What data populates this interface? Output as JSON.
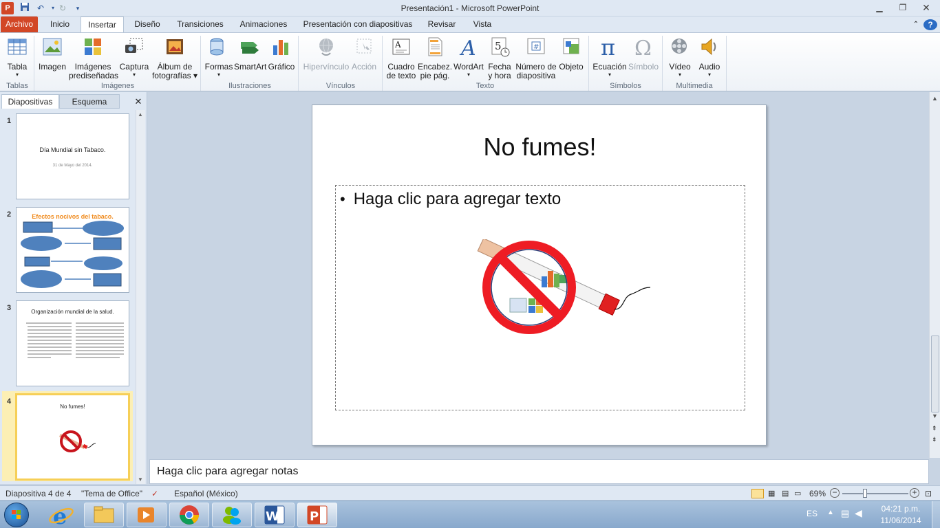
{
  "window": {
    "title": "Presentación1  -  Microsoft PowerPoint"
  },
  "quick_access": {
    "icons": [
      "powerpoint-logo-icon",
      "save-icon",
      "undo-icon",
      "redo-icon",
      "customize-icon"
    ]
  },
  "tabs": [
    {
      "label": "Archivo"
    },
    {
      "label": "Inicio"
    },
    {
      "label": "Insertar"
    },
    {
      "label": "Diseño"
    },
    {
      "label": "Transiciones"
    },
    {
      "label": "Animaciones"
    },
    {
      "label": "Presentación con diapositivas"
    },
    {
      "label": "Revisar"
    },
    {
      "label": "Vista"
    }
  ],
  "ribbon": {
    "buttons": {
      "tabla": "Tabla",
      "imagen": "Imagen",
      "imagenes1": "Imágenes",
      "imagenes2": "prediseñadas",
      "captura": "Captura",
      "album1": "Álbum de",
      "album2": "fotografías",
      "formas": "Formas",
      "smartart": "SmartArt",
      "grafico": "Gráfico",
      "hipervinculo": "Hipervínculo",
      "accion": "Acción",
      "cuadro1": "Cuadro",
      "cuadro2": "de texto",
      "encabez1": "Encabez.",
      "encabez2": "pie pág.",
      "wordart": "WordArt",
      "fecha1": "Fecha",
      "fecha2": "y hora",
      "numero1": "Número de",
      "numero2": "diapositiva",
      "objeto": "Objeto",
      "ecuacion": "Ecuación",
      "simbolo": "Símbolo",
      "video": "Vídeo",
      "audio": "Audio"
    },
    "groups": {
      "tablas": "Tablas",
      "imagenes": "Imágenes",
      "ilustraciones": "Ilustraciones",
      "vinculos": "Vínculos",
      "texto": "Texto",
      "simbolos": "Símbolos",
      "multimedia": "Multimedia"
    }
  },
  "left_pane": {
    "tabs": {
      "diapositivas": "Diapositivas",
      "esquema": "Esquema"
    },
    "slides": [
      {
        "number": "1",
        "title": "Día Mundial sin Tabaco.",
        "subtitle": "31 de Mayo del 2014."
      },
      {
        "number": "2",
        "title": "Efectos nocivos del tabaco."
      },
      {
        "number": "3",
        "title": "Organización mundial de la salud."
      },
      {
        "number": "4",
        "title": "No fumes!"
      }
    ]
  },
  "slide": {
    "title": "No fumes!",
    "bullet": "Haga clic para agregar texto"
  },
  "notes": {
    "placeholder": "Haga clic para agregar notas"
  },
  "status": {
    "slide_info": "Diapositiva 4 de 4",
    "theme": "\"Tema de Office\"",
    "language": "Español (México)",
    "zoom": "69%",
    "zoom_fraction": 0.69
  },
  "taskbar": {
    "apps": [
      "explorer-icon",
      "ie-icon",
      "file-explorer-icon",
      "media-player-icon",
      "chrome-icon",
      "messenger-icon",
      "word-icon",
      "powerpoint-icon"
    ],
    "lang": "ES",
    "time": "04:21 p.m.",
    "date": "11/06/2014"
  },
  "colors": {
    "file_tab": "#d24726",
    "accent": "#2b579a",
    "selected_thumb": "#f6cf57"
  }
}
